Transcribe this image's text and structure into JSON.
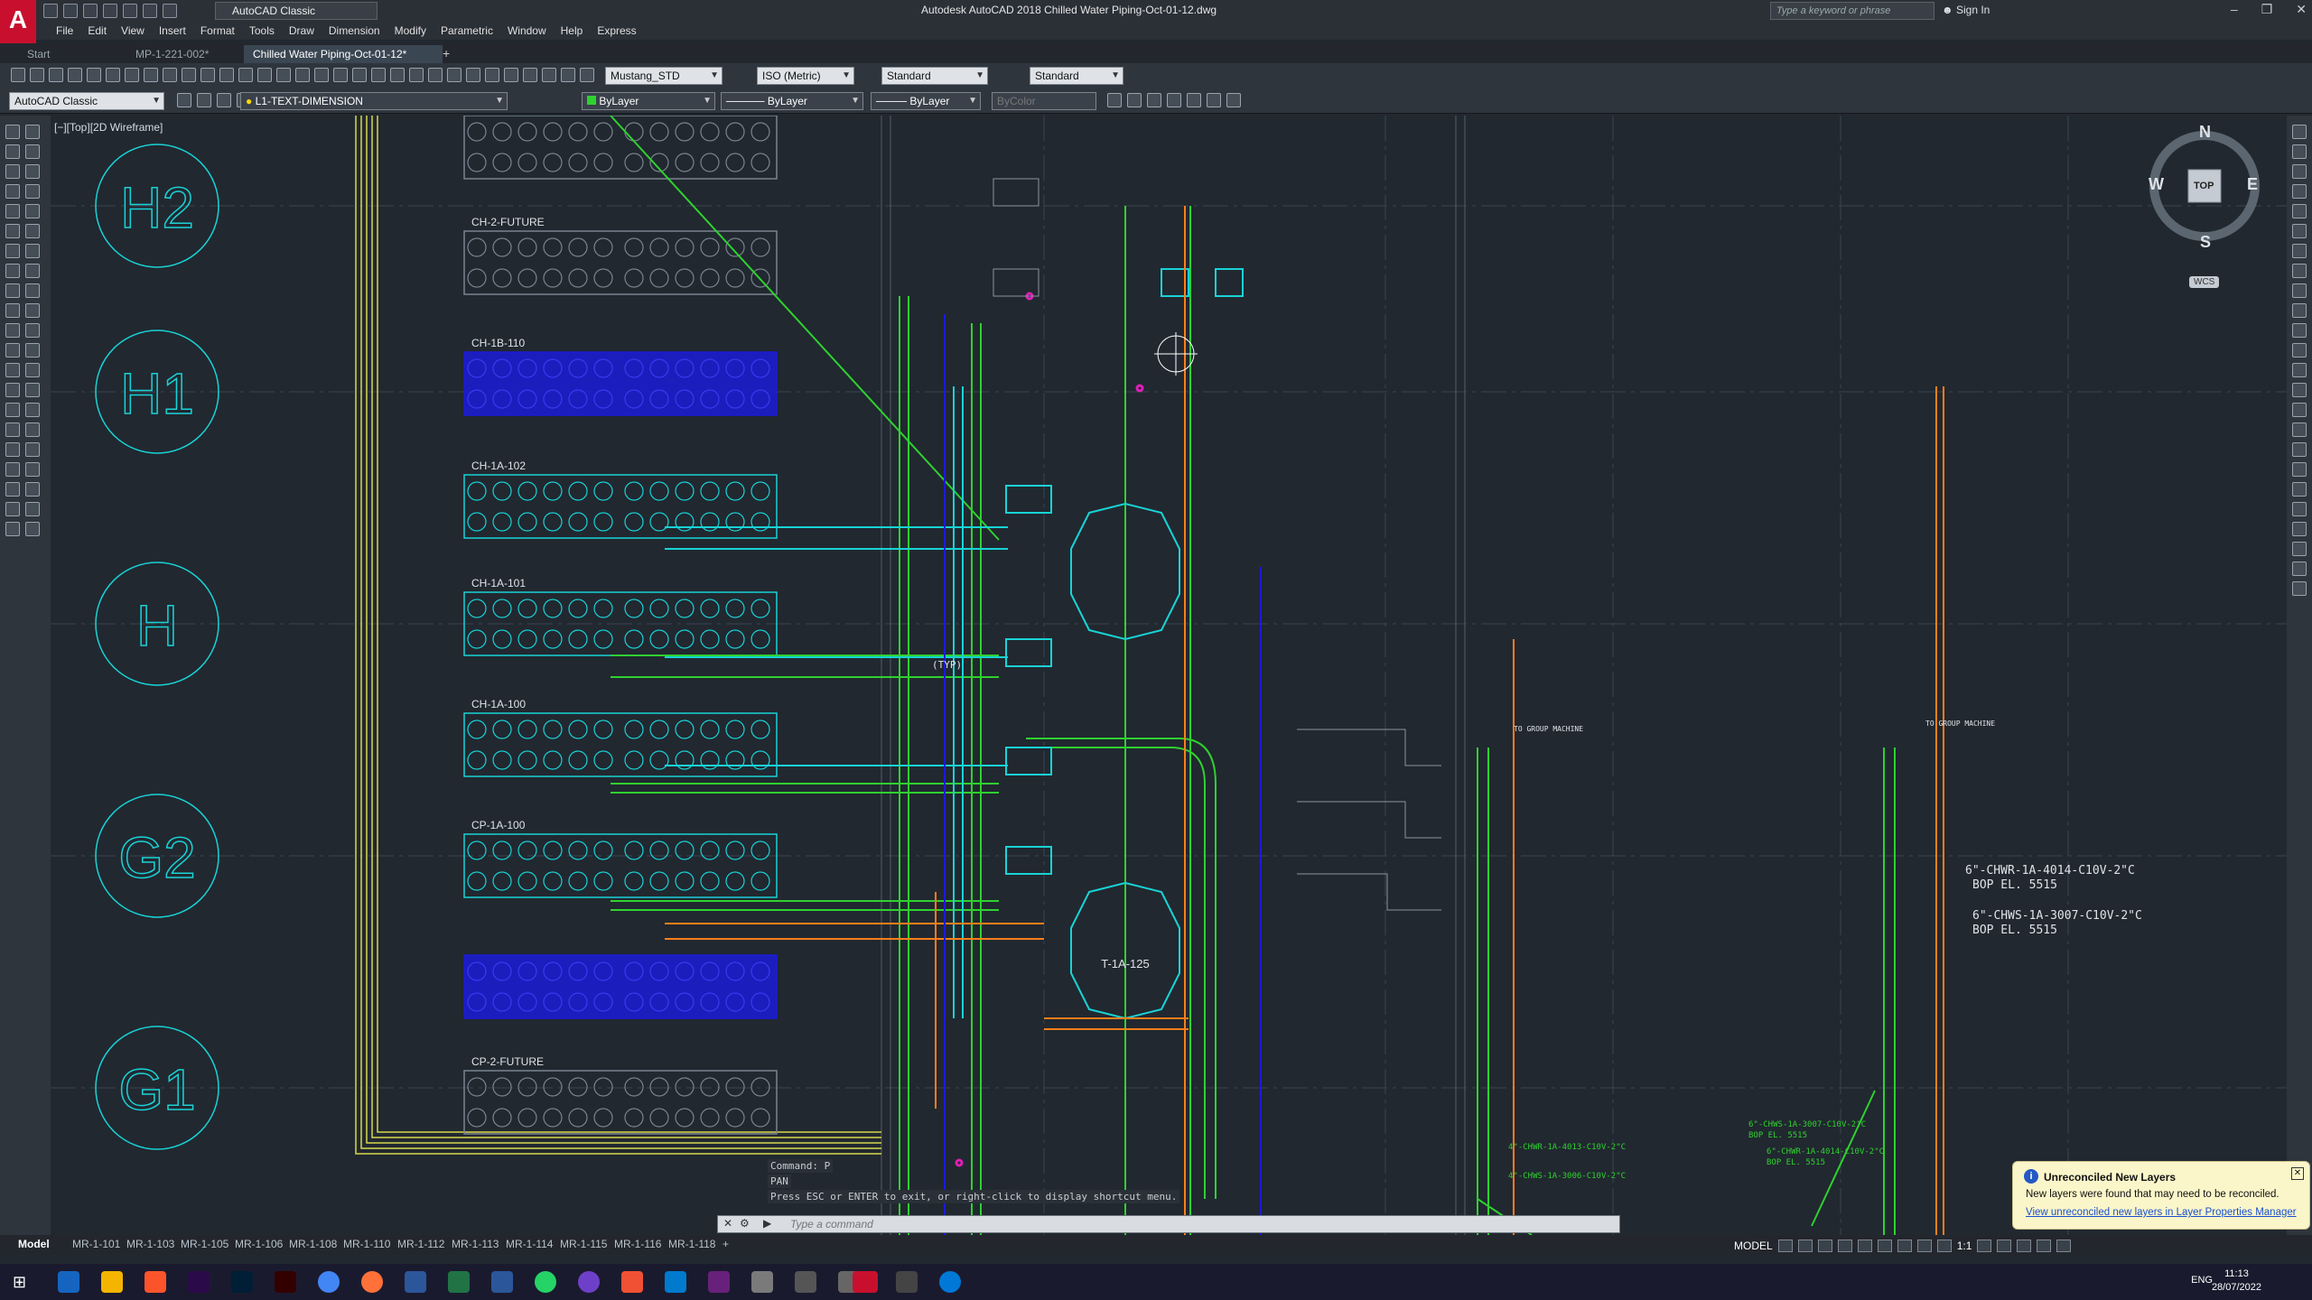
{
  "app": {
    "logo": "A",
    "workspace": "AutoCAD Classic",
    "title": "Autodesk AutoCAD 2018    Chilled Water Piping-Oct-01-12.dwg",
    "search_placeholder": "Type a keyword or phrase",
    "signin": "Sign In"
  },
  "menubar": [
    "File",
    "Edit",
    "View",
    "Insert",
    "Format",
    "Tools",
    "Draw",
    "Dimension",
    "Modify",
    "Parametric",
    "Window",
    "Help",
    "Express"
  ],
  "file_tabs": [
    "Start",
    "MP-1-221-002*",
    "Chilled Water Piping-Oct-01-12*"
  ],
  "styles": {
    "text_style": "Mustang_STD",
    "dim_style": "ISO (Metric)",
    "table_style": "Standard",
    "mleader_style": "Standard"
  },
  "properties": {
    "workspace2": "AutoCAD Classic",
    "layer": "L1-TEXT-DIMENSION",
    "color": "ByLayer",
    "linetype": "ByLayer",
    "lineweight": "ByLayer",
    "plotstyle": "ByColor"
  },
  "viewport_label": "[−][Top][2D Wireframe]",
  "viewcube": {
    "n": "N",
    "s": "S",
    "e": "E",
    "w": "W",
    "face": "TOP",
    "wcs": "WCS"
  },
  "drawing": {
    "grid_bubbles": [
      "H2",
      "H1",
      "H",
      "G2",
      "G1"
    ],
    "equipment": [
      {
        "label": "CH-2-FUTURE"
      },
      {
        "label": "CH-1B-110"
      },
      {
        "label": "CH-1A-102"
      },
      {
        "label": "CH-1A-101"
      },
      {
        "label": "CH-1A-100"
      },
      {
        "label": "CP-1A-100"
      },
      {
        "label": "CP-2-FUTURE"
      }
    ],
    "tanks": [
      "T-1A-125"
    ],
    "notes": [
      "6\"-CHWR-1A-4014-C10V-2\"C",
      "BOP EL. 5515",
      "6\"-CHWS-1A-3007-C10V-2\"C",
      "BOP EL. 5515",
      "6\"-CHWS-1A-3007-C10V-2\"C",
      "BOP EL. 5515",
      "6\"-CHWR-1A-4014-C10V-2\"C",
      "BOP EL. 5515",
      "4\"-CHWR-1A-4013-C10V-2\"C",
      "4\"-CHWS-1A-3006-C10V-2\"C",
      "TO GROUP MACHINE",
      "TO GROUP MACHINE",
      "(TYP)"
    ]
  },
  "command": {
    "history": [
      "Command: P",
      "PAN",
      "Press ESC or ENTER to exit, or right-click to display shortcut menu."
    ],
    "placeholder": "Type a command"
  },
  "layout_tabs": [
    "Model",
    "MR-1-101",
    "MR-1-103",
    "MR-1-105",
    "MR-1-106",
    "MR-1-108",
    "MR-1-110",
    "MR-1-112",
    "MR-1-113",
    "MR-1-114",
    "MR-1-115",
    "MR-1-116",
    "MR-1-118"
  ],
  "status": {
    "model": "MODEL",
    "scale": "1:1"
  },
  "notification": {
    "title": "Unreconciled New Layers",
    "text": "New layers were found that may need to be reconciled.",
    "link": "View unreconciled new layers in Layer Properties Manager"
  },
  "taskbar": {
    "time": "11:13",
    "date": "28/07/2022",
    "lang": "ENG"
  },
  "colors": {
    "accent": "#c8102e",
    "canvas": "#212830",
    "cyan": "#19d3d6",
    "blue": "#1b1bd6",
    "green": "#2fd12f",
    "orange": "#ff7f1a",
    "yellow": "#e8e84a",
    "magenta": "#e01fb8",
    "white": "#dfe3e8"
  }
}
